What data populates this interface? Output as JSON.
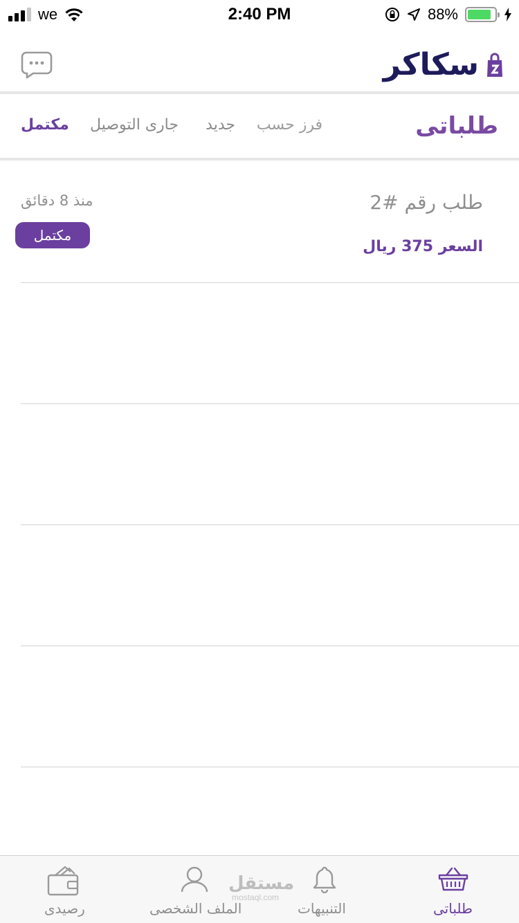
{
  "status_bar": {
    "carrier": "we",
    "time": "2:40 PM",
    "battery_percent": "88%",
    "battery_level": 0.88
  },
  "header": {
    "logo_text": "سكاكر",
    "chat_icon": "chat-bubble-icon"
  },
  "filter_bar": {
    "title": "طلباتى",
    "sort_label": "فرز حسب",
    "tabs": [
      "جديد",
      "جارى التوصيل",
      "مكتمل"
    ],
    "active_tab": "مكتمل"
  },
  "orders": [
    {
      "title": "طلب رقم #2",
      "price": "السعر 375 ريال",
      "time": "منذ 8 دقائق",
      "status": "مكتمل"
    }
  ],
  "tab_bar": {
    "items": [
      {
        "label": "طلباتى",
        "icon": "basket-icon",
        "active": true
      },
      {
        "label": "التنبيهات",
        "icon": "bell-icon",
        "active": false
      },
      {
        "label": "الملف الشخصى",
        "icon": "user-icon",
        "active": false
      },
      {
        "label": "رصيدى",
        "icon": "wallet-icon",
        "active": false
      }
    ]
  },
  "watermark": {
    "text": "مستقل",
    "sub": "mostaql.com"
  },
  "colors": {
    "accent": "#6b3fa0",
    "brand_dark": "#1e1b5a",
    "battery": "#4cd964"
  }
}
